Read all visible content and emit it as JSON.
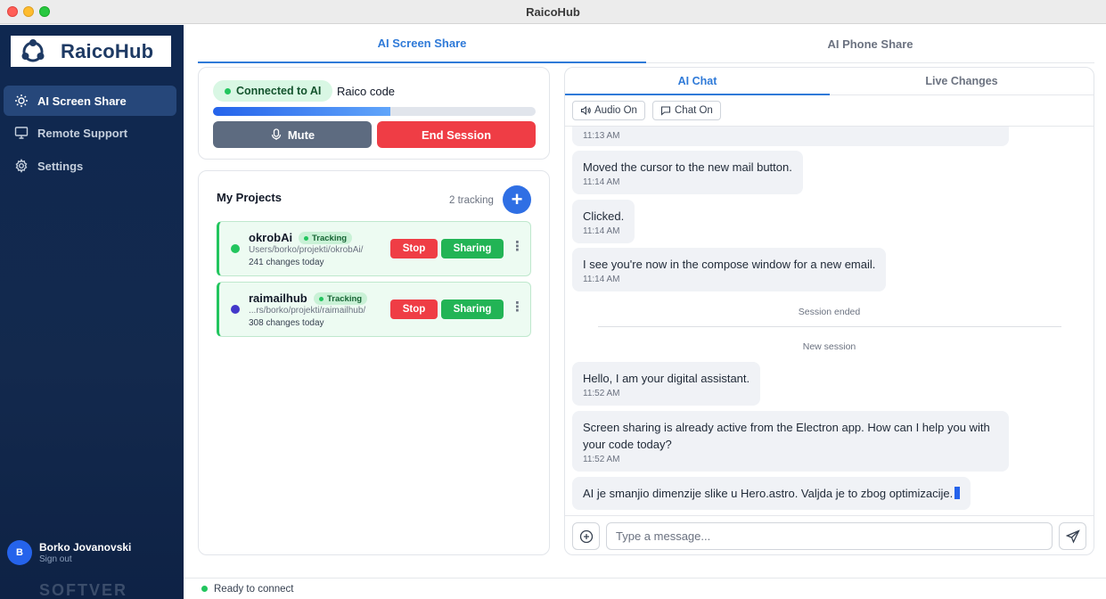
{
  "window": {
    "title": "RaicoHub"
  },
  "sidebar": {
    "logo_text": "RaicoHub",
    "items": [
      {
        "label": "AI Screen Share",
        "icon": "sun-icon",
        "active": true
      },
      {
        "label": "Remote Support",
        "icon": "monitor-icon",
        "active": false
      },
      {
        "label": "Settings",
        "icon": "gear-icon",
        "active": false
      }
    ],
    "user": {
      "initial": "B",
      "name": "Borko Jovanovski",
      "sign_out": "Sign out"
    },
    "watermark": "SOFTVER"
  },
  "main_tabs": [
    {
      "label": "AI Screen Share",
      "active": true
    },
    {
      "label": "AI Phone Share",
      "active": false
    }
  ],
  "session": {
    "status": "Connected to AI",
    "project_label": "Raico code",
    "progress_percent": 55,
    "mute_label": "Mute",
    "end_label": "End Session"
  },
  "projects": {
    "title": "My Projects",
    "tracking_count": "2 tracking",
    "add_label": "+",
    "items": [
      {
        "name": "okrobAi",
        "tag": "Tracking",
        "path": "Users/borko/projekti/okrobAi/",
        "changes": "241 changes today",
        "dot_color": "#22c55e",
        "stop_label": "Stop",
        "share_label": "Sharing"
      },
      {
        "name": "raimailhub",
        "tag": "Tracking",
        "path": "...rs/borko/projekti/raimailhub/",
        "changes": "308 changes today",
        "dot_color": "#4338ca",
        "stop_label": "Stop",
        "share_label": "Sharing"
      }
    ]
  },
  "chat": {
    "tabs": [
      {
        "label": "AI Chat",
        "active": true
      },
      {
        "label": "Live Changes",
        "active": false
      }
    ],
    "audio_label": "Audio On",
    "chat_label": "Chat On",
    "messages": [
      {
        "text": "",
        "time": "11:13 AM"
      },
      {
        "text": "Moved the cursor to the new mail button.",
        "time": "11:14 AM"
      },
      {
        "text": "Clicked.",
        "time": "11:14 AM"
      },
      {
        "text": "I see you're now in the compose window for a new email.",
        "time": "11:14 AM"
      },
      {
        "text": "Hello, I am your digital assistant.",
        "time": "11:52 AM"
      },
      {
        "text": "Screen sharing is already active from the Electron app. How can I help you with your code today?",
        "time": "11:52 AM"
      },
      {
        "text": "AI je smanjio dimenzije slike u Hero.astro. Valjda je to zbog optimizacije.",
        "time": ""
      }
    ],
    "session_ended": "Session ended",
    "new_session": "New session",
    "input_placeholder": "Type a message..."
  },
  "status_bar": {
    "text": "Ready to connect"
  },
  "colors": {
    "accent": "#2f7ad8",
    "danger": "#ef3d45",
    "success": "#22b455",
    "sidebar": "#13294d"
  }
}
